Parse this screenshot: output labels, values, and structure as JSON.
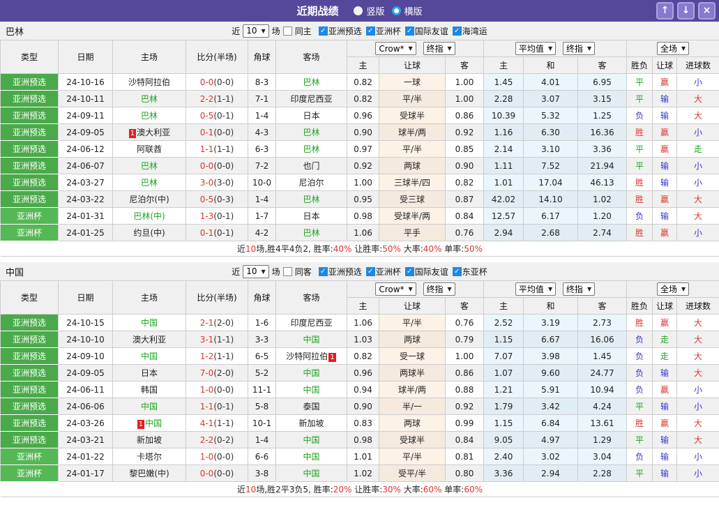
{
  "colors": {
    "titlebar_bg": "#55489B",
    "titlebar_button_bg": "#8679CE",
    "titlebar_button_border": "#AFA3E2",
    "badge_green_qualifier": "#4AAA4A",
    "badge_green_cup": "#55B855",
    "checkbox_blue": "#1E88E5",
    "radio_ring_blue": "#2AA7E8",
    "win_red": "#E03333",
    "draw_green": "#1FA31F",
    "lose_blue": "#3434CF",
    "marker_red": "#E02020"
  },
  "icons": {
    "dropdown": "▼",
    "up": "↑",
    "down": "↓",
    "close": "×",
    "check": "✓"
  },
  "titlebar": {
    "title": "近期战绩",
    "radios": [
      {
        "label": "竖版",
        "selected": true
      },
      {
        "label": "横版",
        "selected": false
      }
    ]
  },
  "table_header": {
    "type": "类型",
    "date": "日期",
    "home": "主场",
    "score": "比分(半场)",
    "corners": "角球",
    "away": "客场",
    "selects": {
      "crow": "Crow*",
      "final1": "终指",
      "avg": "平均值",
      "final2": "终指",
      "full": "全场"
    },
    "sub": {
      "crow_home": "主",
      "crow_handicap": "让球",
      "crow_away": "客",
      "avg_home": "主",
      "avg_draw": "和",
      "avg_away": "客",
      "result": "胜负",
      "handicap": "让球",
      "goals": "进球数"
    }
  },
  "sections": [
    {
      "team": "巴林",
      "filter": {
        "near": "近",
        "count": "10",
        "unit": "场",
        "same": {
          "label": "同主",
          "checked": false
        },
        "leagues": [
          {
            "label": "亚洲预选",
            "checked": true
          },
          {
            "label": "亚洲杯",
            "checked": true
          },
          {
            "label": "国际友谊",
            "checked": true
          },
          {
            "label": "海湾运",
            "checked": true
          }
        ]
      },
      "rows": [
        {
          "type": "亚洲预选",
          "date": "24-10-16",
          "home": {
            "text": "沙特阿拉伯",
            "green": false
          },
          "score": {
            "ft": "0-0",
            "ht": "(0-0)"
          },
          "corners": "8-3",
          "away": {
            "text": "巴林",
            "green": true
          },
          "crow": [
            "0.82",
            "一球",
            "1.00"
          ],
          "avg": [
            "1.45",
            "4.01",
            "6.95"
          ],
          "outcome": [
            [
              "平",
              "green"
            ],
            [
              "赢",
              "red"
            ],
            [
              "小",
              "blue"
            ]
          ]
        },
        {
          "type": "亚洲预选",
          "date": "24-10-11",
          "home": {
            "text": "巴林",
            "green": true
          },
          "score": {
            "ft": "2-2",
            "ht": "(1-1)"
          },
          "corners": "7-1",
          "away": {
            "text": "印度尼西亚",
            "green": false
          },
          "crow": [
            "0.82",
            "平/半",
            "1.00"
          ],
          "avg": [
            "2.28",
            "3.07",
            "3.15"
          ],
          "outcome": [
            [
              "平",
              "green"
            ],
            [
              "输",
              "blue"
            ],
            [
              "大",
              "red"
            ]
          ]
        },
        {
          "type": "亚洲预选",
          "date": "24-09-11",
          "home": {
            "text": "巴林",
            "green": true
          },
          "score": {
            "ft": "0-5",
            "ht": "(0-1)"
          },
          "corners": "1-4",
          "away": {
            "text": "日本",
            "green": false
          },
          "crow": [
            "0.96",
            "受球半",
            "0.86"
          ],
          "avg": [
            "10.39",
            "5.32",
            "1.25"
          ],
          "outcome": [
            [
              "负",
              "blue"
            ],
            [
              "输",
              "blue"
            ],
            [
              "大",
              "red"
            ]
          ]
        },
        {
          "type": "亚洲预选",
          "date": "24-09-05",
          "home": {
            "text": "澳大利亚",
            "green": false,
            "badge": "1",
            "badge_pos": "pre"
          },
          "score": {
            "ft": "0-1",
            "ht": "(0-0)"
          },
          "corners": "4-3",
          "away": {
            "text": "巴林",
            "green": true
          },
          "crow": [
            "0.90",
            "球半/两",
            "0.92"
          ],
          "avg": [
            "1.16",
            "6.30",
            "16.36"
          ],
          "outcome": [
            [
              "胜",
              "red"
            ],
            [
              "赢",
              "red"
            ],
            [
              "小",
              "blue"
            ]
          ]
        },
        {
          "type": "亚洲预选",
          "date": "24-06-12",
          "home": {
            "text": "阿联酋",
            "green": false
          },
          "score": {
            "ft": "1-1",
            "ht": "(1-1)"
          },
          "corners": "6-3",
          "away": {
            "text": "巴林",
            "green": true
          },
          "crow": [
            "0.97",
            "平/半",
            "0.85"
          ],
          "avg": [
            "2.14",
            "3.10",
            "3.36"
          ],
          "outcome": [
            [
              "平",
              "green"
            ],
            [
              "赢",
              "red"
            ],
            [
              "走",
              "green"
            ]
          ]
        },
        {
          "type": "亚洲预选",
          "date": "24-06-07",
          "home": {
            "text": "巴林",
            "green": true
          },
          "score": {
            "ft": "0-0",
            "ht": "(0-0)"
          },
          "corners": "7-2",
          "away": {
            "text": "也门",
            "green": false
          },
          "crow": [
            "0.92",
            "两球",
            "0.90"
          ],
          "avg": [
            "1.11",
            "7.52",
            "21.94"
          ],
          "outcome": [
            [
              "平",
              "green"
            ],
            [
              "输",
              "blue"
            ],
            [
              "小",
              "blue"
            ]
          ]
        },
        {
          "type": "亚洲预选",
          "date": "24-03-27",
          "home": {
            "text": "巴林",
            "green": true
          },
          "score": {
            "ft": "3-0",
            "ht": "(3-0)"
          },
          "corners": "10-0",
          "away": {
            "text": "尼泊尔",
            "green": false
          },
          "crow": [
            "1.00",
            "三球半/四",
            "0.82"
          ],
          "avg": [
            "1.01",
            "17.04",
            "46.13"
          ],
          "outcome": [
            [
              "胜",
              "red"
            ],
            [
              "输",
              "blue"
            ],
            [
              "小",
              "blue"
            ]
          ]
        },
        {
          "type": "亚洲预选",
          "date": "24-03-22",
          "home": {
            "text": "尼泊尔(中)",
            "green": false
          },
          "score": {
            "ft": "0-5",
            "ht": "(0-3)"
          },
          "corners": "1-4",
          "away": {
            "text": "巴林",
            "green": true
          },
          "crow": [
            "0.95",
            "受三球",
            "0.87"
          ],
          "avg": [
            "42.02",
            "14.10",
            "1.02"
          ],
          "outcome": [
            [
              "胜",
              "red"
            ],
            [
              "赢",
              "red"
            ],
            [
              "大",
              "red"
            ]
          ]
        },
        {
          "type": "亚洲杯",
          "date": "24-01-31",
          "home": {
            "text": "巴林(中)",
            "green": true
          },
          "score": {
            "ft": "1-3",
            "ht": "(0-1)"
          },
          "corners": "1-7",
          "away": {
            "text": "日本",
            "green": false
          },
          "crow": [
            "0.98",
            "受球半/两",
            "0.84"
          ],
          "avg": [
            "12.57",
            "6.17",
            "1.20"
          ],
          "outcome": [
            [
              "负",
              "blue"
            ],
            [
              "输",
              "blue"
            ],
            [
              "大",
              "red"
            ]
          ]
        },
        {
          "type": "亚洲杯",
          "date": "24-01-25",
          "home": {
            "text": "约旦(中)",
            "green": false
          },
          "score": {
            "ft": "0-1",
            "ht": "(0-1)"
          },
          "corners": "4-2",
          "away": {
            "text": "巴林",
            "green": true
          },
          "crow": [
            "1.06",
            "平手",
            "0.76"
          ],
          "avg": [
            "2.94",
            "2.68",
            "2.74"
          ],
          "outcome": [
            [
              "胜",
              "red"
            ],
            [
              "赢",
              "red"
            ],
            [
              "小",
              "blue"
            ]
          ]
        }
      ],
      "summary": [
        {
          "t": "近"
        },
        {
          "t": "10",
          "red": true
        },
        {
          "t": "场,胜4平4负2, 胜率:"
        },
        {
          "t": "40%",
          "red": true
        },
        {
          "t": " 让胜率:"
        },
        {
          "t": "50%",
          "red": true
        },
        {
          "t": " 大率:"
        },
        {
          "t": "40%",
          "red": true
        },
        {
          "t": " 单率:"
        },
        {
          "t": "50%",
          "red": true
        }
      ]
    },
    {
      "team": "中国",
      "filter": {
        "near": "近",
        "count": "10",
        "unit": "场",
        "same": {
          "label": "同客",
          "checked": false
        },
        "leagues": [
          {
            "label": "亚洲预选",
            "checked": true
          },
          {
            "label": "亚洲杯",
            "checked": true
          },
          {
            "label": "国际友谊",
            "checked": true
          },
          {
            "label": "东亚杯",
            "checked": true
          }
        ]
      },
      "rows": [
        {
          "type": "亚洲预选",
          "date": "24-10-15",
          "home": {
            "text": "中国",
            "green": true
          },
          "score": {
            "ft": "2-1",
            "ht": "(2-0)"
          },
          "corners": "1-6",
          "away": {
            "text": "印度尼西亚",
            "green": false
          },
          "crow": [
            "1.06",
            "平/半",
            "0.76"
          ],
          "avg": [
            "2.52",
            "3.19",
            "2.73"
          ],
          "outcome": [
            [
              "胜",
              "red"
            ],
            [
              "赢",
              "red"
            ],
            [
              "大",
              "red"
            ]
          ]
        },
        {
          "type": "亚洲预选",
          "date": "24-10-10",
          "home": {
            "text": "澳大利亚",
            "green": false
          },
          "score": {
            "ft": "3-1",
            "ht": "(1-1)"
          },
          "corners": "3-3",
          "away": {
            "text": "中国",
            "green": true
          },
          "crow": [
            "1.03",
            "两球",
            "0.79"
          ],
          "avg": [
            "1.15",
            "6.67",
            "16.06"
          ],
          "outcome": [
            [
              "负",
              "blue"
            ],
            [
              "走",
              "green"
            ],
            [
              "大",
              "red"
            ]
          ]
        },
        {
          "type": "亚洲预选",
          "date": "24-09-10",
          "home": {
            "text": "中国",
            "green": true
          },
          "score": {
            "ft": "1-2",
            "ht": "(1-1)"
          },
          "corners": "6-5",
          "away": {
            "text": "沙特阿拉伯",
            "green": false,
            "badge": "1",
            "badge_pos": "post"
          },
          "crow": [
            "0.82",
            "受一球",
            "1.00"
          ],
          "avg": [
            "7.07",
            "3.98",
            "1.45"
          ],
          "outcome": [
            [
              "负",
              "blue"
            ],
            [
              "走",
              "green"
            ],
            [
              "大",
              "red"
            ]
          ]
        },
        {
          "type": "亚洲预选",
          "date": "24-09-05",
          "home": {
            "text": "日本",
            "green": false
          },
          "score": {
            "ft": "7-0",
            "ht": "(2-0)"
          },
          "corners": "5-2",
          "away": {
            "text": "中国",
            "green": true
          },
          "crow": [
            "0.96",
            "两球半",
            "0.86"
          ],
          "avg": [
            "1.07",
            "9.60",
            "24.77"
          ],
          "outcome": [
            [
              "负",
              "blue"
            ],
            [
              "输",
              "blue"
            ],
            [
              "大",
              "red"
            ]
          ]
        },
        {
          "type": "亚洲预选",
          "date": "24-06-11",
          "home": {
            "text": "韩国",
            "green": false
          },
          "score": {
            "ft": "1-0",
            "ht": "(0-0)"
          },
          "corners": "11-1",
          "away": {
            "text": "中国",
            "green": true
          },
          "crow": [
            "0.94",
            "球半/两",
            "0.88"
          ],
          "avg": [
            "1.21",
            "5.91",
            "10.94"
          ],
          "outcome": [
            [
              "负",
              "blue"
            ],
            [
              "赢",
              "red"
            ],
            [
              "小",
              "blue"
            ]
          ]
        },
        {
          "type": "亚洲预选",
          "date": "24-06-06",
          "home": {
            "text": "中国",
            "green": true
          },
          "score": {
            "ft": "1-1",
            "ht": "(0-1)"
          },
          "corners": "5-8",
          "away": {
            "text": "泰国",
            "green": false
          },
          "crow": [
            "0.90",
            "半/一",
            "0.92"
          ],
          "avg": [
            "1.79",
            "3.42",
            "4.24"
          ],
          "outcome": [
            [
              "平",
              "green"
            ],
            [
              "输",
              "blue"
            ],
            [
              "小",
              "blue"
            ]
          ]
        },
        {
          "type": "亚洲预选",
          "date": "24-03-26",
          "home": {
            "text": "中国",
            "green": true,
            "badge": "1",
            "badge_pos": "pre"
          },
          "score": {
            "ft": "4-1",
            "ht": "(1-1)"
          },
          "corners": "10-1",
          "away": {
            "text": "新加坡",
            "green": false
          },
          "crow": [
            "0.83",
            "两球",
            "0.99"
          ],
          "avg": [
            "1.15",
            "6.84",
            "13.61"
          ],
          "outcome": [
            [
              "胜",
              "red"
            ],
            [
              "赢",
              "red"
            ],
            [
              "大",
              "red"
            ]
          ]
        },
        {
          "type": "亚洲预选",
          "date": "24-03-21",
          "home": {
            "text": "新加坡",
            "green": false
          },
          "score": {
            "ft": "2-2",
            "ht": "(0-2)"
          },
          "corners": "1-4",
          "away": {
            "text": "中国",
            "green": true
          },
          "crow": [
            "0.98",
            "受球半",
            "0.84"
          ],
          "avg": [
            "9.05",
            "4.97",
            "1.29"
          ],
          "outcome": [
            [
              "平",
              "green"
            ],
            [
              "输",
              "blue"
            ],
            [
              "大",
              "red"
            ]
          ]
        },
        {
          "type": "亚洲杯",
          "date": "24-01-22",
          "home": {
            "text": "卡塔尔",
            "green": false
          },
          "score": {
            "ft": "1-0",
            "ht": "(0-0)"
          },
          "corners": "6-6",
          "away": {
            "text": "中国",
            "green": true
          },
          "crow": [
            "1.01",
            "平/半",
            "0.81"
          ],
          "avg": [
            "2.40",
            "3.02",
            "3.04"
          ],
          "outcome": [
            [
              "负",
              "blue"
            ],
            [
              "输",
              "blue"
            ],
            [
              "小",
              "blue"
            ]
          ]
        },
        {
          "type": "亚洲杯",
          "date": "24-01-17",
          "home": {
            "text": "黎巴嫩(中)",
            "green": false
          },
          "score": {
            "ft": "0-0",
            "ht": "(0-0)"
          },
          "corners": "3-8",
          "away": {
            "text": "中国",
            "green": true
          },
          "crow": [
            "1.02",
            "受平/半",
            "0.80"
          ],
          "avg": [
            "3.36",
            "2.94",
            "2.28"
          ],
          "outcome": [
            [
              "平",
              "green"
            ],
            [
              "输",
              "blue"
            ],
            [
              "小",
              "blue"
            ]
          ]
        }
      ],
      "summary": [
        {
          "t": "近"
        },
        {
          "t": "10",
          "red": true
        },
        {
          "t": "场,胜2平3负5, 胜率:"
        },
        {
          "t": "20%",
          "red": true
        },
        {
          "t": " 让胜率:"
        },
        {
          "t": "30%",
          "red": true
        },
        {
          "t": " 大率:"
        },
        {
          "t": "60%",
          "red": true
        },
        {
          "t": " 单率:"
        },
        {
          "t": "60%",
          "red": true
        }
      ]
    }
  ]
}
